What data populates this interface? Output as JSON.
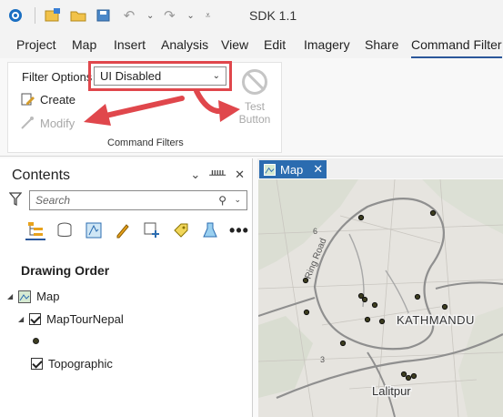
{
  "app": {
    "title": "SDK 1.1"
  },
  "tabs": [
    "Project",
    "Map",
    "Insert",
    "Analysis",
    "View",
    "Edit",
    "Imagery",
    "Share",
    "Command Filter"
  ],
  "ribbon": {
    "filter_options_label": "Filter Options",
    "filter_value": "UI Disabled",
    "create_label": "Create",
    "modify_label": "Modify",
    "test_button_label": "Test Button",
    "group_label": "Command Filters"
  },
  "contents": {
    "title": "Contents",
    "search_placeholder": "Search",
    "drawing_order": "Drawing Order",
    "tree": {
      "map": "Map",
      "layer1": "MapTourNepal",
      "layer2": "Topographic"
    }
  },
  "map": {
    "tab_label": "Map",
    "labels": {
      "kathmandu": "KATHMANDU",
      "lalitpur": "Lalitpur",
      "road": "Ring Road",
      "n6": "6",
      "n3": "3"
    }
  },
  "colors": {
    "accent": "#2b579a",
    "highlight": "#e0474c",
    "map_tab": "#2b6cb0"
  }
}
